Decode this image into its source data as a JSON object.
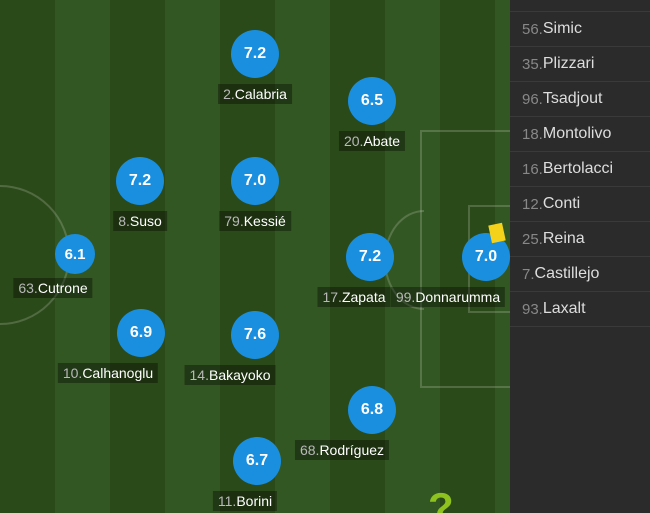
{
  "players": [
    {
      "num": "2.",
      "name": "Calabria",
      "rating": "7.2"
    },
    {
      "num": "20.",
      "name": "Abate",
      "rating": "6.5"
    },
    {
      "num": "8.",
      "name": "Suso",
      "rating": "7.2"
    },
    {
      "num": "79.",
      "name": "Kessié",
      "rating": "7.0"
    },
    {
      "num": "63.",
      "name": "Cutrone",
      "rating": "6.1"
    },
    {
      "num": "17.",
      "name": "Zapata",
      "rating": "7.2"
    },
    {
      "num": "99.",
      "name": "Donnarumma",
      "rating": "7.0"
    },
    {
      "num": "10.",
      "name": "Calhanoglu",
      "rating": "6.9"
    },
    {
      "num": "14.",
      "name": "Bakayoko",
      "rating": "7.6"
    },
    {
      "num": "68.",
      "name": "Rodríguez",
      "rating": "6.8"
    },
    {
      "num": "11.",
      "name": "Borini",
      "rating": "6.7"
    }
  ],
  "substitutes": [
    {
      "num": "56.",
      "name": "Simic"
    },
    {
      "num": "35.",
      "name": "Plizzari"
    },
    {
      "num": "96.",
      "name": "Tsadjout"
    },
    {
      "num": "18.",
      "name": "Montolivo"
    },
    {
      "num": "16.",
      "name": "Bertolacci"
    },
    {
      "num": "12.",
      "name": "Conti"
    },
    {
      "num": "25.",
      "name": "Reina"
    },
    {
      "num": "7.",
      "name": "Castillejo"
    },
    {
      "num": "93.",
      "name": "Laxalt"
    }
  ],
  "colors": {
    "rating_bubble": "#1a8fe0",
    "yellow_card": "#f4d21c"
  },
  "icons": {
    "card": "yellow-card-icon",
    "logo": "help-logo-icon"
  }
}
